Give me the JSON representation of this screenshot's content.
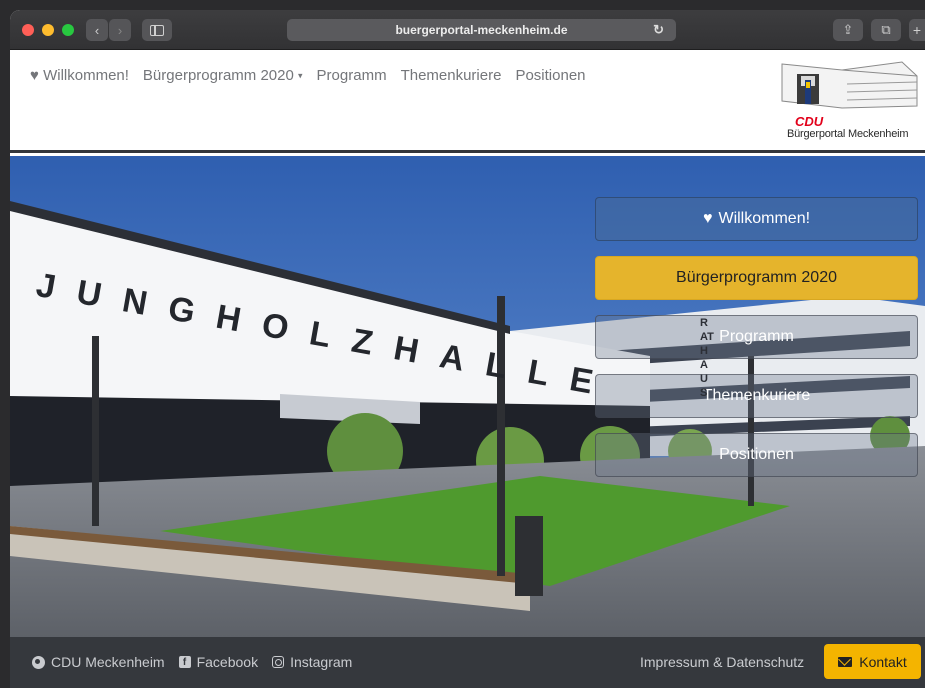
{
  "browser": {
    "url": "buergerportal-meckenheim.de",
    "reload_icon": "↻",
    "back_icon": "‹",
    "forward_icon": "›",
    "share_icon": "⇪",
    "tabs_icon": "⧉",
    "newtab_icon": "+"
  },
  "nav": {
    "items": [
      {
        "icon": "heart-icon",
        "label": "Willkommen!"
      },
      {
        "label": "Bürgerprogramm 2020",
        "dropdown": true
      },
      {
        "label": "Programm"
      },
      {
        "label": "Themenkuriere"
      },
      {
        "label": "Positionen"
      }
    ],
    "heart_glyph": "♥",
    "caret_glyph": "▾"
  },
  "logo": {
    "party": "CDU",
    "subtitle": "Bürgerportal Meckenheim"
  },
  "hero": {
    "building_text": "JUNGHOLZHALLE",
    "side_text": "RATHAUS",
    "buttons": [
      {
        "label": "Willkommen!",
        "icon": "heart-icon",
        "style": "ghost"
      },
      {
        "label": "Bürgerprogramm 2020",
        "style": "yellow"
      },
      {
        "label": "Programm",
        "style": "glass"
      },
      {
        "label": "Themenkuriere",
        "style": "glass"
      },
      {
        "label": "Positionen",
        "style": "glass"
      }
    ]
  },
  "footer": {
    "links": [
      {
        "icon": "globe-icon",
        "label": "CDU Meckenheim"
      },
      {
        "icon": "facebook-icon",
        "label": "Facebook"
      },
      {
        "icon": "instagram-icon",
        "label": "Instagram"
      }
    ],
    "impressum": "Impressum & Datenschutz",
    "contact_button": "Kontakt",
    "facebook_glyph": "f"
  },
  "colors": {
    "accent_yellow": "#e5b42c",
    "kontakt_yellow": "#f4b400",
    "footer_bg": "#35383d",
    "cdu_red": "#e2001a"
  }
}
